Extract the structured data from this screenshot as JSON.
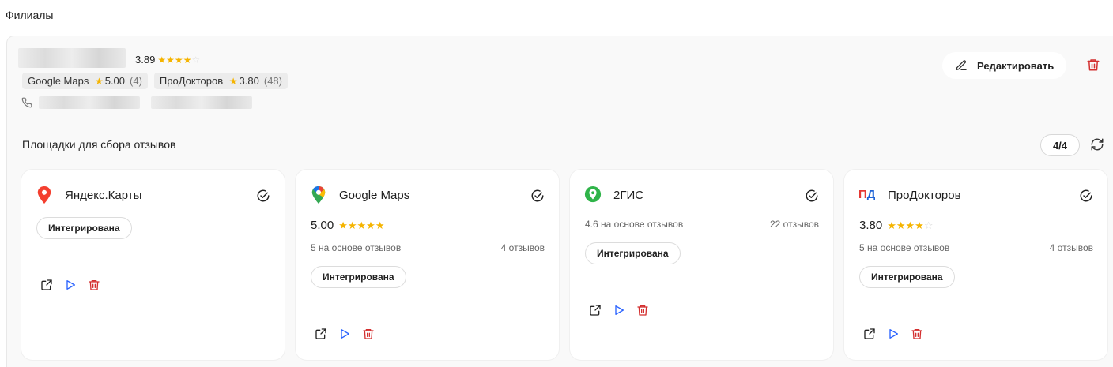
{
  "page": {
    "title": "Филиалы"
  },
  "branch": {
    "rating": "3.89",
    "rating_value": 3.89,
    "chips": [
      {
        "name": "Google Maps",
        "rating": "5.00",
        "count": "(4)"
      },
      {
        "name": "ПроДокторов",
        "rating": "3.80",
        "count": "(48)"
      }
    ],
    "edit_label": "Редактировать"
  },
  "platforms": {
    "title": "Площадки для сбора отзывов",
    "counter": "4/4",
    "cards": [
      {
        "name": "Яндекс.Карты",
        "status": "Интегрирована"
      },
      {
        "name": "Google Maps",
        "rating": "5.00",
        "rating_value": 5,
        "basis": "5 на основе отзывов",
        "reviews": "4 отзывов",
        "status": "Интегрирована"
      },
      {
        "name": "2ГИС",
        "basis": "4.6 на основе отзывов",
        "reviews": "22 отзывов",
        "status": "Интегрирована"
      },
      {
        "name": "ПроДокторов",
        "logo_text": "ПД",
        "rating": "3.80",
        "rating_value": 3.8,
        "basis": "5 на основе отзывов",
        "reviews": "4 отзывов",
        "status": "Интегрирована"
      }
    ]
  },
  "colors": {
    "star": "#f5b400",
    "delete": "#d32f2f",
    "play": "#2962ff",
    "yandex": "#f43f2f",
    "dgis": "#2fb449",
    "pd_red": "#e53935",
    "pd_blue": "#1e63d6"
  }
}
